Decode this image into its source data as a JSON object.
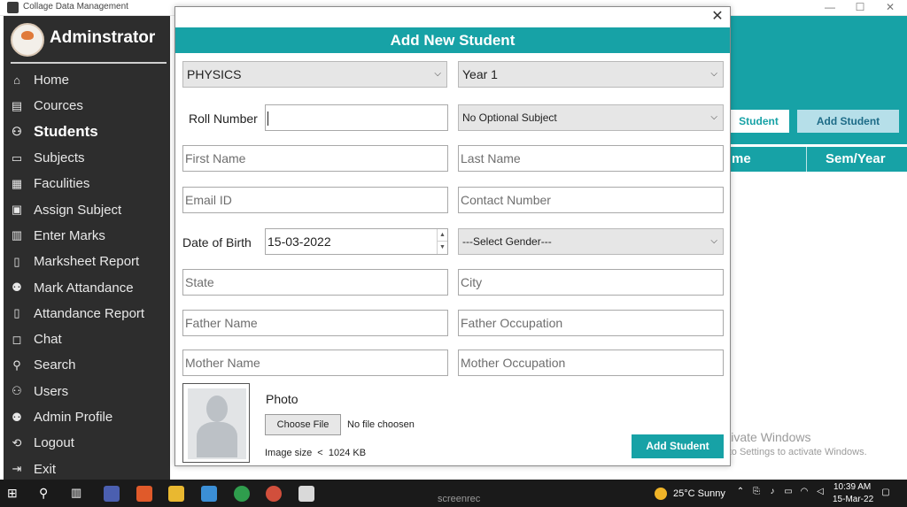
{
  "window": {
    "title": "Collage Data Management"
  },
  "sidebar": {
    "brand_title": "Adminstrator",
    "items": [
      {
        "label": "Home",
        "icon": "home-icon"
      },
      {
        "label": "Cources",
        "icon": "courses-icon"
      },
      {
        "label": "Students",
        "icon": "students-icon",
        "active": true
      },
      {
        "label": "Subjects",
        "icon": "book-icon"
      },
      {
        "label": "Faculities",
        "icon": "faculty-icon"
      },
      {
        "label": "Assign Subject",
        "icon": "assign-icon"
      },
      {
        "label": "Enter Marks",
        "icon": "marks-icon"
      },
      {
        "label": "Marksheet Report",
        "icon": "report-icon"
      },
      {
        "label": "Mark Attandance",
        "icon": "attendance-icon"
      },
      {
        "label": "Attandance Report",
        "icon": "document-icon"
      },
      {
        "label": "Chat",
        "icon": "chat-icon"
      },
      {
        "label": "Search",
        "icon": "search-user-icon"
      },
      {
        "label": "Users",
        "icon": "users-icon"
      },
      {
        "label": "Admin Profile",
        "icon": "profile-icon"
      },
      {
        "label": "Logout",
        "icon": "logout-icon"
      },
      {
        "label": "Exit",
        "icon": "exit-icon"
      }
    ]
  },
  "background": {
    "btn_student_partial": "Student",
    "btn_add_student": "Add Student",
    "col_name_partial": "me",
    "col_sem": "Sem/Year"
  },
  "dialog": {
    "title": "Add New Student",
    "close_label": "✕",
    "department": "PHYSICS",
    "year": "Year 1",
    "roll_label": "Roll Number",
    "roll_value": "",
    "optional_subject": "No Optional Subject",
    "first_name_placeholder": "First Name",
    "last_name_placeholder": "Last Name",
    "email_placeholder": "Email ID",
    "contact_placeholder": "Contact Number",
    "dob_label": "Date of Birth",
    "dob_value": "15-03-2022",
    "gender": "---Select Gender---",
    "state_placeholder": "State",
    "city_placeholder": "City",
    "father_name_placeholder": "Father Name",
    "father_occupation_placeholder": "Father Occupation",
    "mother_name_placeholder": "Mother Name",
    "mother_occupation_placeholder": "Mother Occupation",
    "photo_label": "Photo",
    "choose_file": "Choose File",
    "no_file": "No file choosen",
    "image_size": "Image size  <  1024 KB",
    "submit": "Add Student"
  },
  "watermark": {
    "line1": "Activate Windows",
    "line2": "Go to Settings to activate Windows."
  },
  "taskbar": {
    "weather": "25°C  Sunny",
    "time": "10:39 AM",
    "date": "15-Mar-22",
    "recorder": "screenrec"
  },
  "colors": {
    "accent": "#17a2a6",
    "sidebar": "#2d2d2d"
  }
}
